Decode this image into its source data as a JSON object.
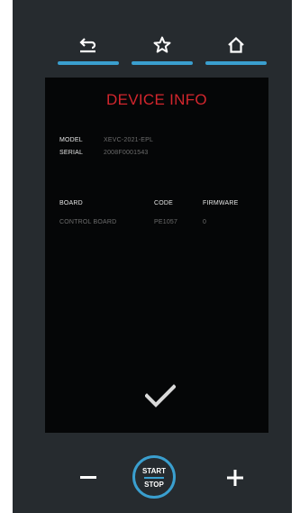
{
  "nav": {
    "back_icon": "back-arrow-icon",
    "favorite_icon": "star-icon",
    "home_icon": "home-icon",
    "accent_color": "#3a9fcf"
  },
  "screen": {
    "title": "DEVICE INFO",
    "title_color": "#d3262d",
    "model_label": "MODEL",
    "model_value": "XEVC-2021-EPL",
    "serial_label": "SERIAL",
    "serial_value": "2008F0001543",
    "table": {
      "headers": [
        "BOARD",
        "CODE",
        "FIRMWARE"
      ],
      "rows": [
        [
          "CONTROL BOARD",
          "PE1057",
          "0"
        ]
      ]
    },
    "confirm_icon": "checkmark-icon"
  },
  "controls": {
    "minus_icon": "minus-icon",
    "plus_icon": "plus-icon",
    "start_label": "START",
    "stop_label": "STOP"
  }
}
